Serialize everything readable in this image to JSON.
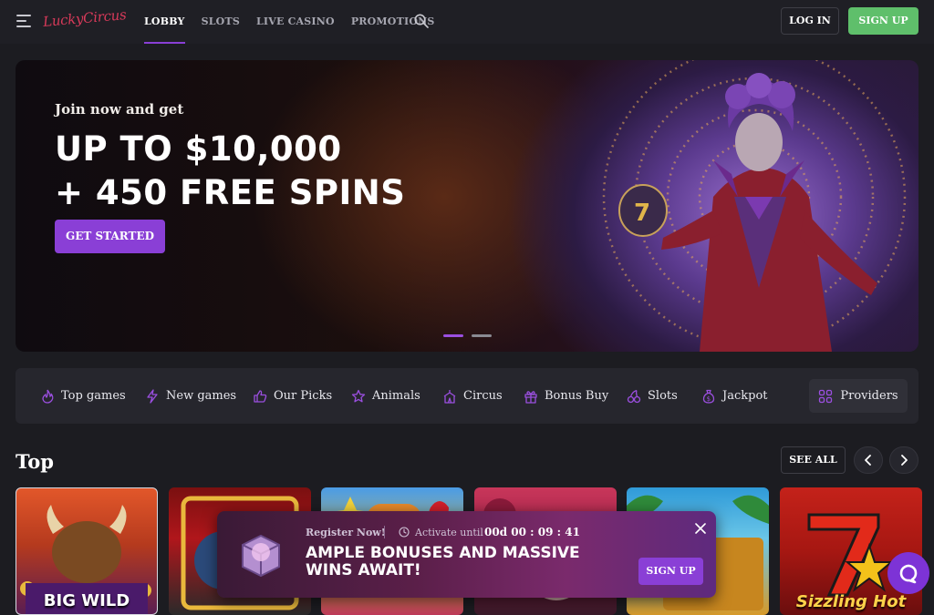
{
  "header": {
    "logo": "LuckyCircus",
    "nav": [
      "LOBBY",
      "SLOTS",
      "LIVE CASINO",
      "PROMOTIONS"
    ],
    "active_nav": "LOBBY",
    "login_label": "LOG IN",
    "signup_label": "SIGN UP"
  },
  "hero": {
    "eyebrow": "Join now and get",
    "title_line1": "UP TO $10,000",
    "title_line2": "+ 450 FREE SPINS",
    "cta_label": "GET STARTED",
    "slide_count": 2,
    "active_slide": 1
  },
  "categories": {
    "items": [
      {
        "label": "Top games",
        "icon": "flame-icon"
      },
      {
        "label": "New games",
        "icon": "lightning-icon"
      },
      {
        "label": "Our Picks",
        "icon": "thumbs-up-icon"
      },
      {
        "label": "Animals",
        "icon": "star-icon"
      },
      {
        "label": "Circus",
        "icon": "circus-tent-icon"
      },
      {
        "label": "Bonus Buy",
        "icon": "gift-icon"
      },
      {
        "label": "Slots",
        "icon": "cherries-icon"
      },
      {
        "label": "Jackpot",
        "icon": "money-bag-icon"
      }
    ],
    "providers_label": "Providers"
  },
  "top_section": {
    "title": "Top",
    "see_all_label": "SEE ALL",
    "games": [
      {
        "title": "BIG WILD"
      },
      {
        "title": ""
      },
      {
        "title": ""
      },
      {
        "title": ""
      },
      {
        "title": ""
      },
      {
        "title": "Sizzling Hot"
      }
    ]
  },
  "promo": {
    "register_label": "Register Now!",
    "activate_label": "Activate until",
    "timer": "00d 00 : 09 : 41",
    "headline": "AMPLE BONUSES AND MASSIVE WINS AWAIT!",
    "signup_label": "SIGN UP"
  },
  "colors": {
    "accent": "#8a3fd6",
    "signup_green": "#5fbf6b",
    "background": "#1c1c21",
    "logo_red": "#d83a5a"
  }
}
